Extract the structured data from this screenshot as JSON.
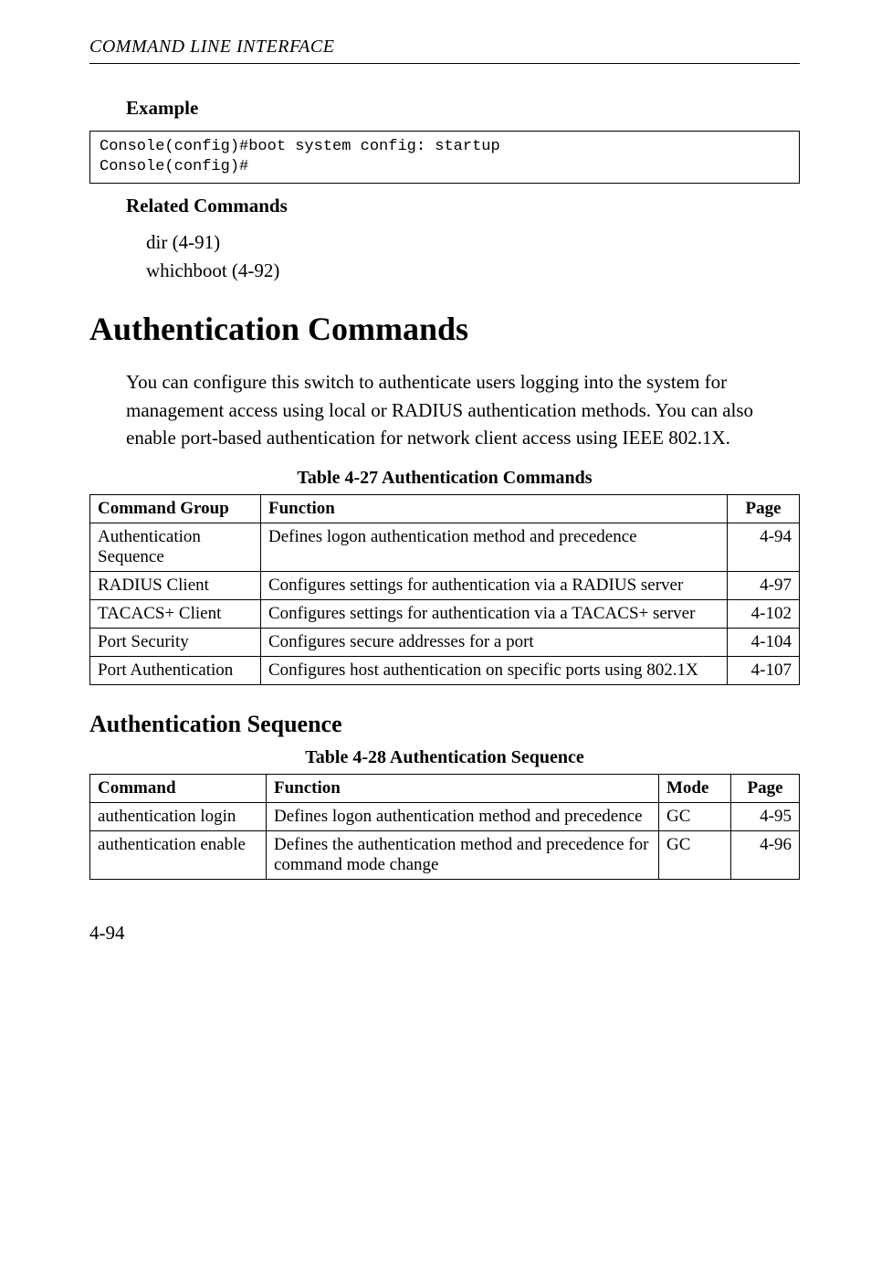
{
  "runningHead": "COMMAND LINE INTERFACE",
  "example": {
    "heading": "Example",
    "code": "Console(config)#boot system config: startup\nConsole(config)#"
  },
  "related": {
    "heading": "Related Commands",
    "items": [
      "dir (4-91)",
      "whichboot (4-92)"
    ]
  },
  "sectionTitle": "Authentication Commands",
  "intro": "You can configure this switch to authenticate users logging into the system for management access using local or RADIUS authentication methods. You can also enable port-based authentication for network client access using IEEE 802.1X.",
  "table1": {
    "caption": "Table 4-27  Authentication Commands",
    "headers": {
      "group": "Command Group",
      "func": "Function",
      "page": "Page"
    },
    "rows": [
      {
        "group": "Authentication Sequence",
        "func": "Defines logon authentication method and precedence",
        "page": "4-94"
      },
      {
        "group": "RADIUS Client",
        "func": "Configures settings for authentication via a RADIUS server",
        "page": "4-97"
      },
      {
        "group": "TACACS+ Client",
        "func": "Configures settings for authentication via a TACACS+ server",
        "page": "4-102"
      },
      {
        "group": "Port Security",
        "func": "Configures secure addresses for a port",
        "page": "4-104"
      },
      {
        "group": "Port Authentication",
        "func": "Configures host authentication on specific ports using 802.1X",
        "page": "4-107"
      }
    ]
  },
  "subsectionTitle": "Authentication Sequence",
  "table2": {
    "caption": "Table 4-28  Authentication Sequence",
    "headers": {
      "cmd": "Command",
      "func": "Function",
      "mode": "Mode",
      "page": "Page"
    },
    "rows": [
      {
        "cmd": "authentication login",
        "func": "Defines logon authentication method and precedence",
        "mode": "GC",
        "page": "4-95"
      },
      {
        "cmd": "authentication enable",
        "func": "Defines the authentication method and precedence for  command mode change",
        "mode": "GC",
        "page": "4-96"
      }
    ]
  },
  "pageNumber": "4-94"
}
